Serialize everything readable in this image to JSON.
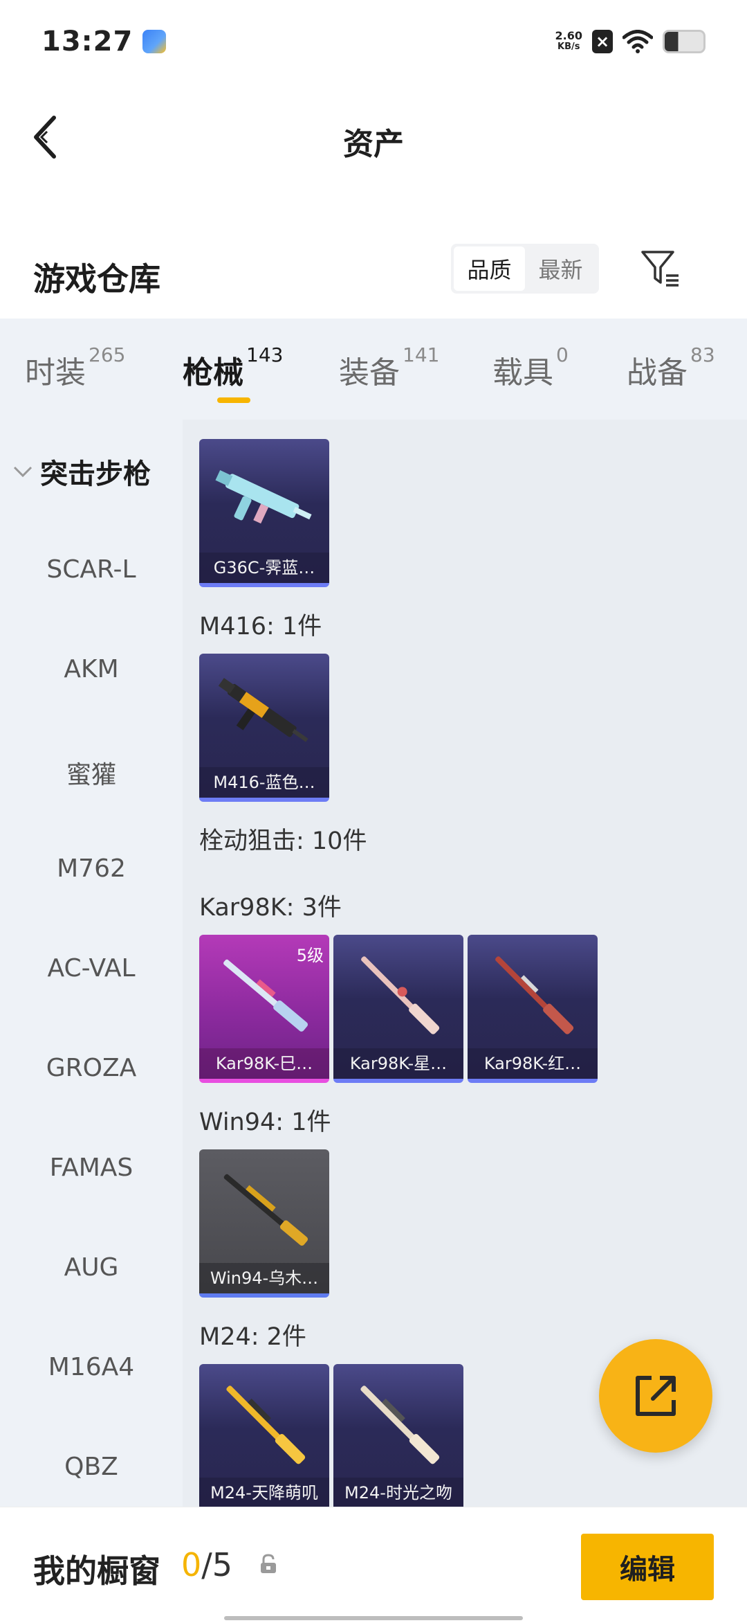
{
  "status_bar": {
    "time": "13:27",
    "net_speed": "2.60",
    "net_unit": "KB/s",
    "icons": [
      "app-icon",
      "x-icon",
      "wifi-icon",
      "battery-icon"
    ]
  },
  "header": {
    "title": "资产",
    "back_icon": "chevron-left-icon"
  },
  "warehouse": {
    "title": "游戏仓库",
    "sort_options": [
      "品质",
      "最新"
    ],
    "sort_selected": "品质",
    "filter_icon": "filter-icon"
  },
  "tabs": [
    {
      "label": "时装",
      "count": "265",
      "active": false
    },
    {
      "label": "枪械",
      "count": "143",
      "active": true
    },
    {
      "label": "装备",
      "count": "141",
      "active": false
    },
    {
      "label": "载具",
      "count": "0",
      "active": false
    },
    {
      "label": "战备",
      "count": "83",
      "active": false
    }
  ],
  "sidebar": {
    "group_label": "突击步枪",
    "items": [
      "SCAR-L",
      "AKM",
      "蜜獾",
      "M762",
      "AC-VAL",
      "GROZA",
      "FAMAS",
      "AUG",
      "M16A4",
      "QBZ"
    ]
  },
  "content": {
    "sections": [
      {
        "label": "",
        "cards": [
          {
            "name": "G36C-霁蓝…",
            "level": "",
            "rarity": "purple"
          }
        ]
      },
      {
        "label": "M416: 1件",
        "cards": [
          {
            "name": "M416-蓝色…",
            "level": "",
            "rarity": "purple"
          }
        ]
      },
      {
        "label": "栓动狙击: 10件",
        "cards": []
      },
      {
        "label": "Kar98K: 3件",
        "cards": [
          {
            "name": "Kar98K-巳…",
            "level": "5级",
            "rarity": "pink"
          },
          {
            "name": "Kar98K-星…",
            "level": "",
            "rarity": "purple"
          },
          {
            "name": "Kar98K-红…",
            "level": "",
            "rarity": "purple"
          }
        ]
      },
      {
        "label": "Win94: 1件",
        "cards": [
          {
            "name": "Win94-乌木…",
            "level": "",
            "rarity": "gray"
          }
        ]
      },
      {
        "label": "M24: 2件",
        "cards": [
          {
            "name": "M24-天降萌叽",
            "level": "",
            "rarity": "purple"
          },
          {
            "name": "M24-时光之吻",
            "level": "",
            "rarity": "purple"
          }
        ]
      }
    ]
  },
  "fab": {
    "icon": "share-icon"
  },
  "bottom_bar": {
    "label": "我的橱窗",
    "current": "0",
    "separator_total": "/5",
    "lock_icon": "lock-icon",
    "edit_label": "编辑"
  },
  "colors": {
    "accent": "#f7b500",
    "tab_bg": "#eef2f7",
    "content_bg": "#e9edf2"
  }
}
